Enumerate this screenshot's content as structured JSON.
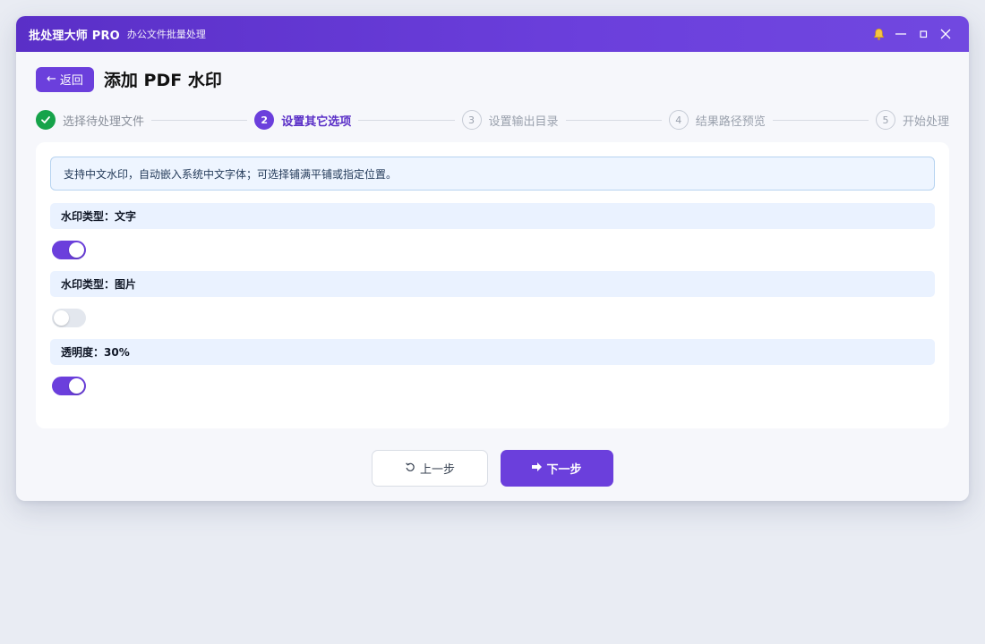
{
  "app": {
    "title": "批处理大师 PRO",
    "subtitle": "办公文件批量处理"
  },
  "header": {
    "back_label": "返回",
    "page_title": "添加 PDF 水印"
  },
  "steps": [
    {
      "index": "1",
      "label": "选择待处理文件",
      "state": "done"
    },
    {
      "index": "2",
      "label": "设置其它选项",
      "state": "active"
    },
    {
      "index": "3",
      "label": "设置输出目录",
      "state": "pending"
    },
    {
      "index": "4",
      "label": "结果路径预览",
      "state": "pending"
    },
    {
      "index": "5",
      "label": "开始处理",
      "state": "pending"
    }
  ],
  "info_text": "支持中文水印，自动嵌入系统中文字体；可选择铺满平铺或指定位置。",
  "options": [
    {
      "label": "水印类型：文字",
      "enabled": true
    },
    {
      "label": "水印类型：图片",
      "enabled": false
    },
    {
      "label": "透明度：30%",
      "enabled": true
    }
  ],
  "footer": {
    "prev_label": "上一步",
    "next_label": "下一步"
  },
  "colors": {
    "accent": "#6b3fdc",
    "success": "#16a34a",
    "info_bg": "#eef5ff"
  },
  "icons": {
    "bell": "bell-icon",
    "minimize": "minimize-icon",
    "maximize": "maximize-icon",
    "close": "close-icon",
    "back": "arrow-left-icon",
    "check": "check-icon",
    "prev": "undo-icon",
    "next": "play-icon"
  }
}
